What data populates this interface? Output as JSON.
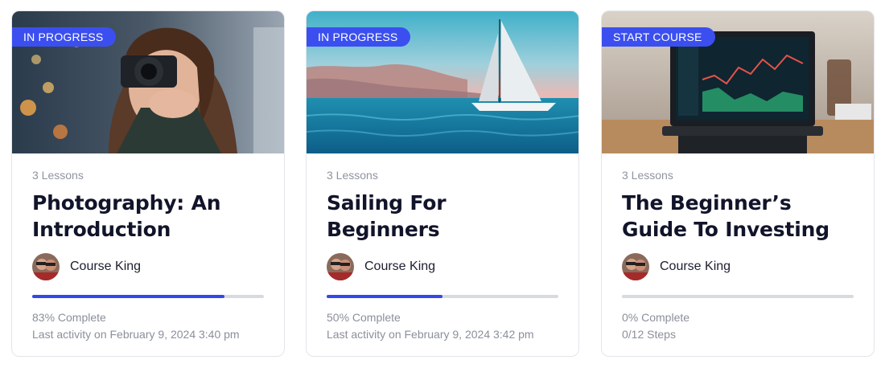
{
  "courses": [
    {
      "badge": "IN PROGRESS",
      "lessons": "3 Lessons",
      "title": "Photography: An Introduction",
      "author": "Course King",
      "progress": 0.83,
      "status": "83% Complete",
      "detail": "Last activity on February 9, 2024 3:40 pm"
    },
    {
      "badge": "IN PROGRESS",
      "lessons": "3 Lessons",
      "title": "Sailing For Beginners",
      "author": "Course King",
      "progress": 0.5,
      "status": "50% Complete",
      "detail": "Last activity on February 9, 2024 3:42 pm"
    },
    {
      "badge": "START COURSE",
      "lessons": "3 Lessons",
      "title": "The Beginner’s Guide To Investing",
      "author": "Course King",
      "progress": 0,
      "status": "0% Complete",
      "detail": "0/12 Steps"
    }
  ],
  "colors": {
    "accent": "#3b4ff0",
    "progress_fill": "#3248e8",
    "progress_track": "#d8dae1"
  }
}
